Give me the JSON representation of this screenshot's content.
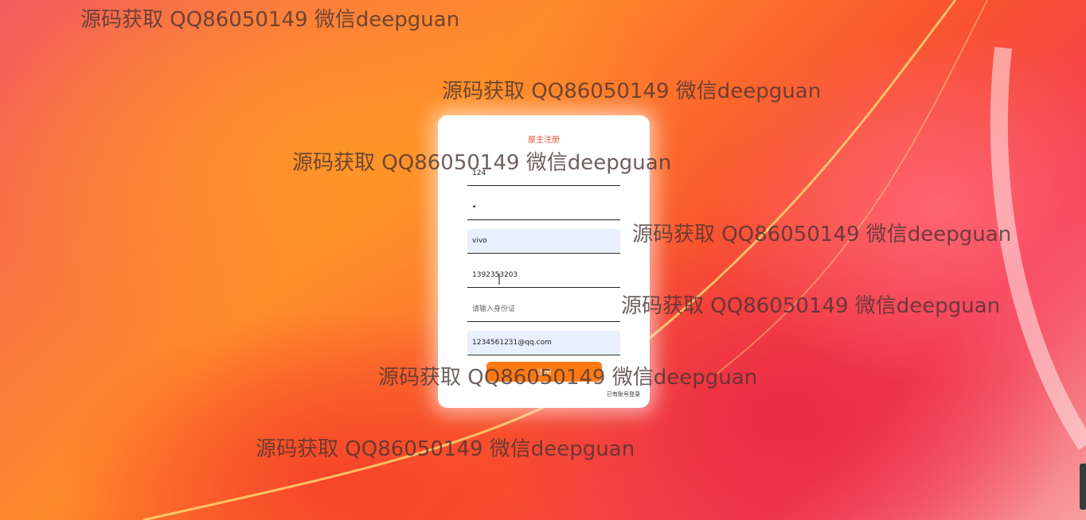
{
  "form": {
    "title": "屋主注册",
    "fields": [
      {
        "name": "username-field",
        "value": "124",
        "placeholder": "",
        "filled": false
      },
      {
        "name": "password-field",
        "value": "•",
        "placeholder": "",
        "filled": false
      },
      {
        "name": "name-field",
        "value": "vivo",
        "placeholder": "",
        "filled": true
      },
      {
        "name": "phone-field",
        "value": "1392353203",
        "placeholder": "",
        "filled": false
      },
      {
        "name": "id-card-field",
        "value": "",
        "placeholder": "请输入身份证",
        "filled": false
      },
      {
        "name": "email-field",
        "value": "1234561231@qq.com",
        "placeholder": "",
        "filled": true
      }
    ],
    "submit_label": "注册",
    "login_link": "已有账号登录"
  },
  "watermark": {
    "text": "源码获取 QQ86050149 微信deepguan"
  },
  "colors": {
    "title": "#e0553a",
    "submit": "#ff7a14",
    "autofill": "#e8f0fe"
  }
}
